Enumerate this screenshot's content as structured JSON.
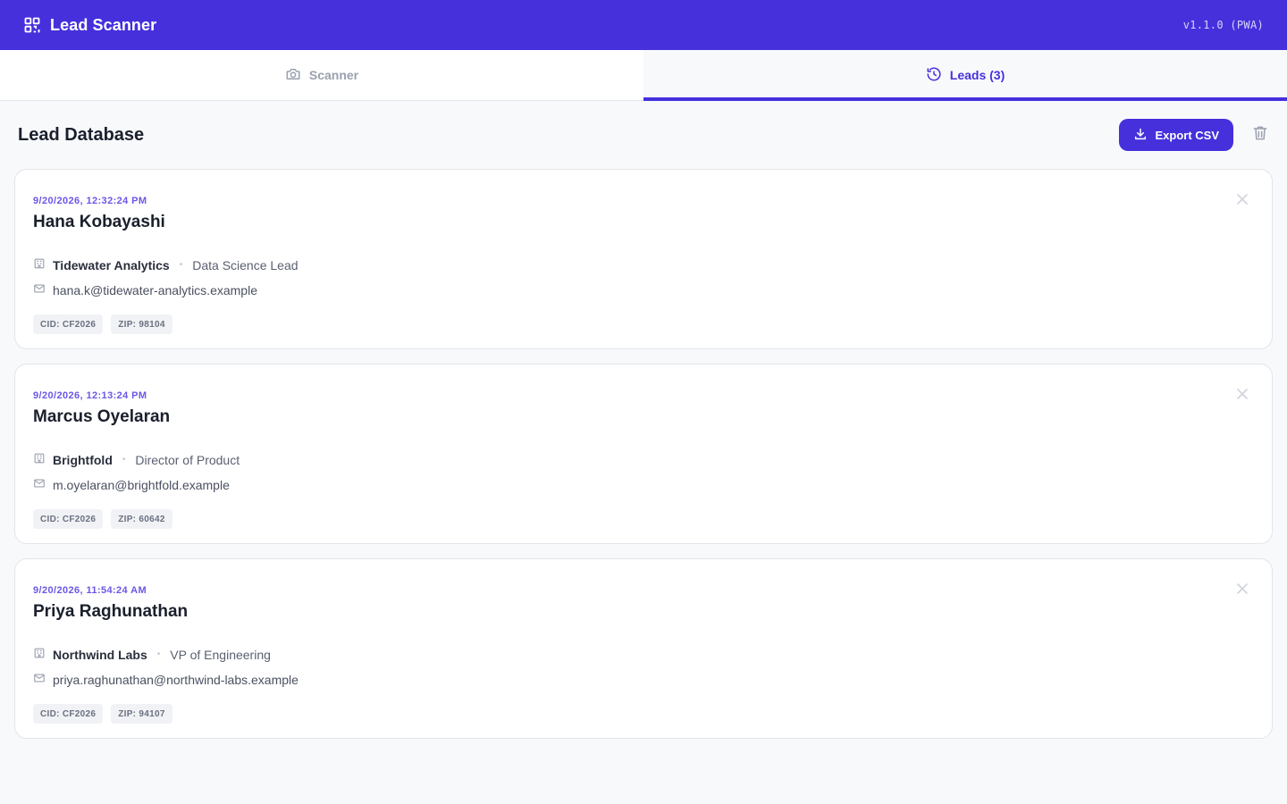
{
  "app": {
    "title": "Lead Scanner",
    "version": "v1.1.0 (PWA)",
    "brand_icon": "qr-code-icon"
  },
  "tabs": [
    {
      "label": "Scanner",
      "icon": "camera-icon",
      "active": false
    },
    {
      "label": "Leads (3)",
      "icon": "history-icon",
      "active": true
    }
  ],
  "page": {
    "title": "Lead Database",
    "export_label": "Export CSV"
  },
  "leads": [
    {
      "timestamp": "9/20/2026, 12:32:24 PM",
      "name": "Hana Kobayashi",
      "company": "Tidewater Analytics",
      "role": "Data Science Lead",
      "email": "hana.k@tidewater-analytics.example",
      "cid": "CID: CF2026",
      "zip": "ZIP: 98104"
    },
    {
      "timestamp": "9/20/2026, 12:13:24 PM",
      "name": "Marcus Oyelaran",
      "company": "Brightfold",
      "role": "Director of Product",
      "email": "m.oyelaran@brightfold.example",
      "cid": "CID: CF2026",
      "zip": "ZIP: 60642"
    },
    {
      "timestamp": "9/20/2026, 11:54:24 AM",
      "name": "Priya Raghunathan",
      "company": "Northwind Labs",
      "role": "VP of Engineering",
      "email": "priya.raghunathan@northwind-labs.example",
      "cid": "CID: CF2026",
      "zip": "ZIP: 94107"
    }
  ],
  "colors": {
    "accent": "#4530dc",
    "timestamp": "#6a57e6",
    "background": "#f8f9fb"
  },
  "separator": "•"
}
